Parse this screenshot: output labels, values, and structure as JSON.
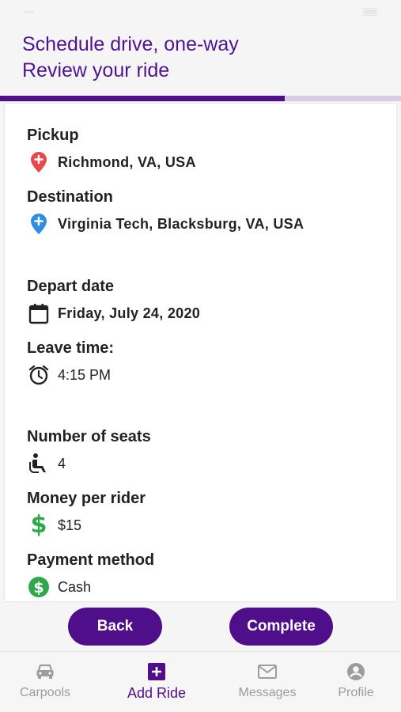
{
  "header": {
    "line1": "Schedule drive, one-way",
    "line2": "Review your ride"
  },
  "progress": {
    "fraction": 0.71
  },
  "fields": {
    "pickup": {
      "label": "Pickup",
      "value": "Richmond, VA, USA",
      "icon": "location-pin-red-icon"
    },
    "destination": {
      "label": "Destination",
      "value": "Virginia Tech, Blacksburg, VA, USA",
      "icon": "location-pin-blue-icon"
    },
    "depart_date": {
      "label": "Depart date",
      "value": "Friday, July 24, 2020",
      "icon": "calendar-icon"
    },
    "leave_time": {
      "label": "Leave time:",
      "value": "4:15 PM",
      "icon": "alarm-clock-icon"
    },
    "seats": {
      "label": "Number of seats",
      "value": "4",
      "icon": "seat-icon"
    },
    "money": {
      "label": "Money per rider",
      "value": "$15",
      "icon": "dollar-icon"
    },
    "payment": {
      "label": "Payment method",
      "value": "Cash",
      "icon": "cash-icon"
    }
  },
  "buttons": {
    "back": "Back",
    "complete": "Complete"
  },
  "nav": {
    "carpools": "Carpools",
    "add_ride": "Add Ride",
    "messages": "Messages",
    "profile": "Profile"
  },
  "colors": {
    "brand_purple": "#4f0f8a",
    "header_text": "#4f1590",
    "pin_red": "#e8474b",
    "pin_blue": "#2f8de4",
    "money_green": "#2ea84a",
    "nav_inactive": "#9c9c9c"
  }
}
